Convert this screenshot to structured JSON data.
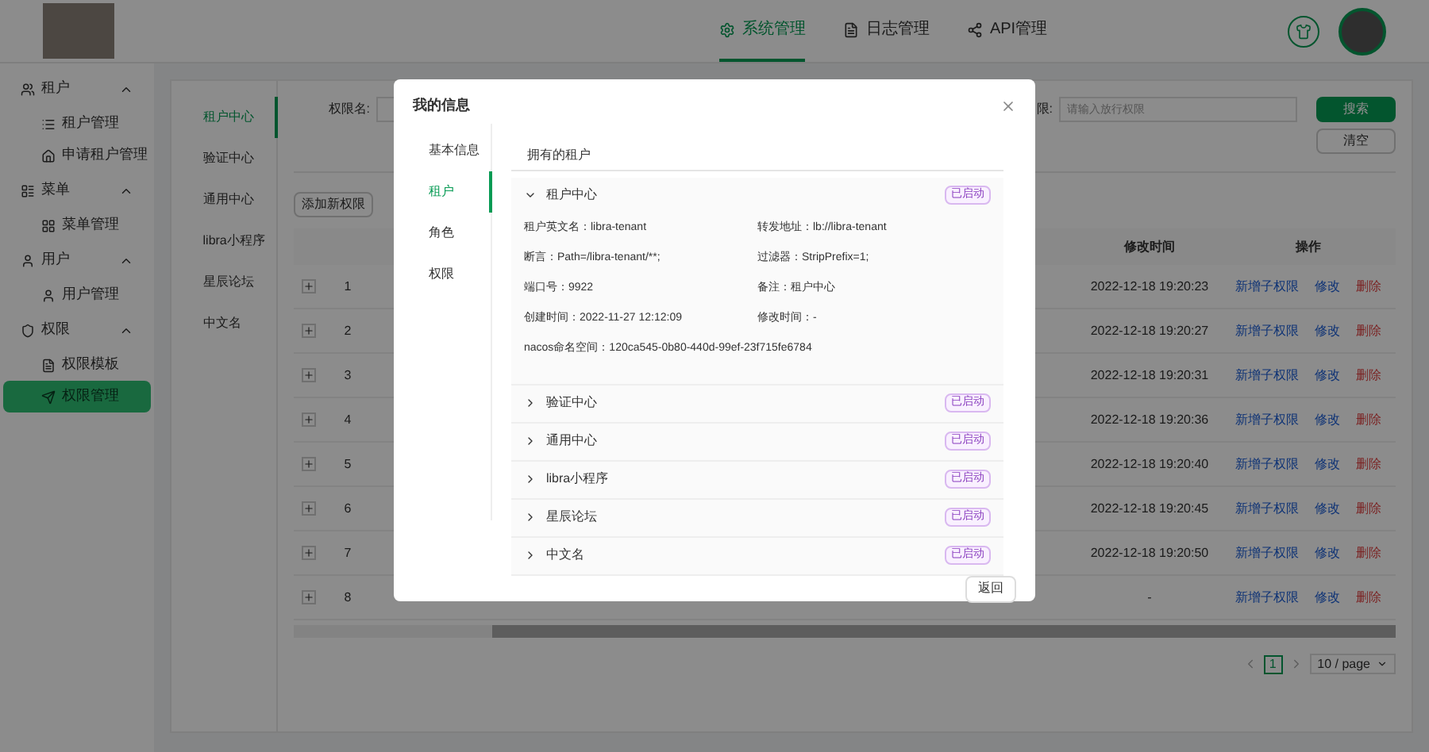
{
  "header": {
    "nav": [
      {
        "label": "系统管理",
        "selected": true
      },
      {
        "label": "日志管理",
        "selected": false
      },
      {
        "label": "API管理",
        "selected": false
      }
    ]
  },
  "sidebar": {
    "groups": [
      {
        "label": "租户",
        "expanded": true,
        "children": [
          {
            "label": "租户管理",
            "selected": false
          },
          {
            "label": "申请租户管理",
            "selected": false
          }
        ]
      },
      {
        "label": "菜单",
        "expanded": true,
        "children": [
          {
            "label": "菜单管理",
            "selected": false
          }
        ]
      },
      {
        "label": "用户",
        "expanded": true,
        "children": [
          {
            "label": "用户管理",
            "selected": false
          }
        ]
      },
      {
        "label": "权限",
        "expanded": true,
        "children": [
          {
            "label": "权限模板",
            "selected": false
          },
          {
            "label": "权限管理",
            "selected": true
          }
        ]
      }
    ]
  },
  "main": {
    "categories": [
      {
        "label": "租户中心",
        "selected": true
      },
      {
        "label": "验证中心",
        "selected": false
      },
      {
        "label": "通用中心",
        "selected": false
      },
      {
        "label": "libra小程序",
        "selected": false
      },
      {
        "label": "星辰论坛",
        "selected": false
      },
      {
        "label": "中文名",
        "selected": false
      }
    ],
    "filters": [
      {
        "label": "权限名:"
      },
      {
        "label": "限:",
        "placeholder": "请输入放行权限"
      }
    ],
    "search_button": "搜索",
    "clear_button": "清空",
    "add_button": "添加新权限",
    "table": {
      "columns": [
        "修改时间",
        "操作"
      ],
      "rows": [
        {
          "index": "1",
          "modified": "2022-12-18 19:20:23",
          "actions": [
            {
              "label": "新增子权限",
              "kind": "link"
            },
            {
              "label": "修改",
              "kind": "link"
            },
            {
              "label": "删除",
              "kind": "danger"
            }
          ]
        },
        {
          "index": "2",
          "modified": "2022-12-18 19:20:27",
          "actions": [
            {
              "label": "新增子权限",
              "kind": "link"
            },
            {
              "label": "修改",
              "kind": "link"
            },
            {
              "label": "删除",
              "kind": "danger"
            }
          ]
        },
        {
          "index": "3",
          "modified": "2022-12-18 19:20:31",
          "actions": [
            {
              "label": "新增子权限",
              "kind": "link"
            },
            {
              "label": "修改",
              "kind": "link"
            },
            {
              "label": "删除",
              "kind": "danger"
            }
          ]
        },
        {
          "index": "4",
          "modified": "2022-12-18 19:20:36",
          "actions": [
            {
              "label": "新增子权限",
              "kind": "link"
            },
            {
              "label": "修改",
              "kind": "link"
            },
            {
              "label": "删除",
              "kind": "danger"
            }
          ]
        },
        {
          "index": "5",
          "modified": "2022-12-18 19:20:40",
          "actions": [
            {
              "label": "新增子权限",
              "kind": "link"
            },
            {
              "label": "修改",
              "kind": "link"
            },
            {
              "label": "删除",
              "kind": "danger"
            }
          ]
        },
        {
          "index": "6",
          "modified": "2022-12-18 19:20:45",
          "actions": [
            {
              "label": "新增子权限",
              "kind": "link"
            },
            {
              "label": "修改",
              "kind": "link"
            },
            {
              "label": "删除",
              "kind": "danger"
            }
          ]
        },
        {
          "index": "7",
          "modified": "2022-12-18 19:20:50",
          "actions": [
            {
              "label": "新增子权限",
              "kind": "link"
            },
            {
              "label": "修改",
              "kind": "link"
            },
            {
              "label": "删除",
              "kind": "danger"
            }
          ]
        },
        {
          "index": "8",
          "modified": "-",
          "actions": [
            {
              "label": "新增子权限",
              "kind": "link"
            },
            {
              "label": "修改",
              "kind": "link"
            },
            {
              "label": "删除",
              "kind": "danger"
            }
          ]
        }
      ]
    },
    "pagination": {
      "pages": [
        {
          "label": "1",
          "selected": true
        }
      ],
      "page_size": "10 / page"
    }
  },
  "modal": {
    "title": "我的信息",
    "tabs": [
      {
        "label": "基本信息",
        "selected": false
      },
      {
        "label": "租户",
        "selected": true
      },
      {
        "label": "角色",
        "selected": false
      },
      {
        "label": "权限",
        "selected": false
      }
    ],
    "section_title": "拥有的租户",
    "tenants": [
      {
        "name": "租户中心",
        "expanded": true,
        "status": "已启动",
        "fields": [
          "租户英文名：libra-tenant",
          "转发地址：lb://libra-tenant",
          "断言：Path=/libra-tenant/**;",
          "过滤器：StripPrefix=1;",
          "端口号：9922",
          "备注：租户中心",
          "创建时间：2022-11-27 12:12:09",
          "修改时间：-",
          "nacos命名空间：120ca545-0b80-440d-99ef-23f715fe6784"
        ]
      },
      {
        "name": "验证中心",
        "expanded": false,
        "status": "已启动"
      },
      {
        "name": "通用中心",
        "expanded": false,
        "status": "已启动"
      },
      {
        "name": "libra小程序",
        "expanded": false,
        "status": "已启动"
      },
      {
        "name": "星辰论坛",
        "expanded": false,
        "status": "已启动"
      },
      {
        "name": "中文名",
        "expanded": false,
        "status": "已启动"
      }
    ],
    "back_button": "返回"
  }
}
